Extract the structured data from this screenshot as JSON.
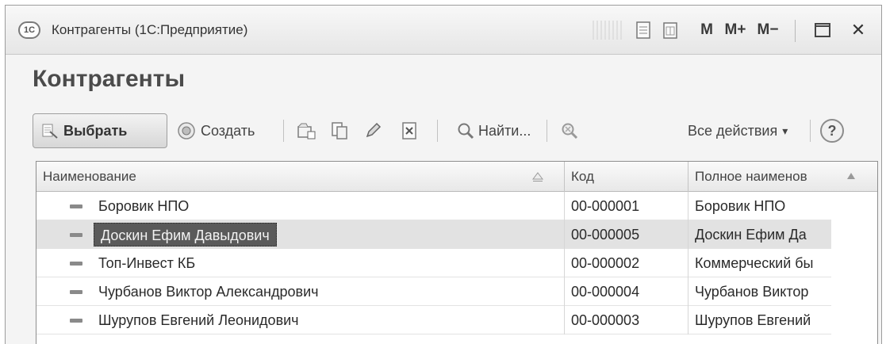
{
  "window": {
    "app_badge": "1С",
    "title": "Контрагенты (1С:Предприятие)",
    "buttons": {
      "m": "M",
      "m_plus": "M+",
      "m_minus": "M−",
      "close": "✕"
    }
  },
  "form": {
    "title": "Контрагенты"
  },
  "toolbar": {
    "select_label": "Выбрать",
    "create_label": "Создать",
    "find_label": "Найти...",
    "all_actions_label": "Все действия",
    "all_actions_arrow": "▾",
    "help_label": "?"
  },
  "table": {
    "columns": [
      {
        "label": "Наименование"
      },
      {
        "label": "Код"
      },
      {
        "label": "Полное наименов"
      }
    ],
    "rows": [
      {
        "name": "Боровик НПО",
        "code": "00-000001",
        "full_name": "Боровик НПО",
        "selected": false
      },
      {
        "name": "Доскин Ефим Давыдович",
        "code": "00-000005",
        "full_name": "Доскин Ефим Да",
        "selected": true
      },
      {
        "name": "Топ-Инвест КБ",
        "code": "00-000002",
        "full_name": "Коммерческий бы",
        "selected": false
      },
      {
        "name": "Чурбанов Виктор Александрович",
        "code": "00-000004",
        "full_name": "Чурбанов Виктор",
        "selected": false
      },
      {
        "name": "Шурупов Евгений Леонидович",
        "code": "00-000003",
        "full_name": "Шурупов Евгений",
        "selected": false
      }
    ]
  }
}
